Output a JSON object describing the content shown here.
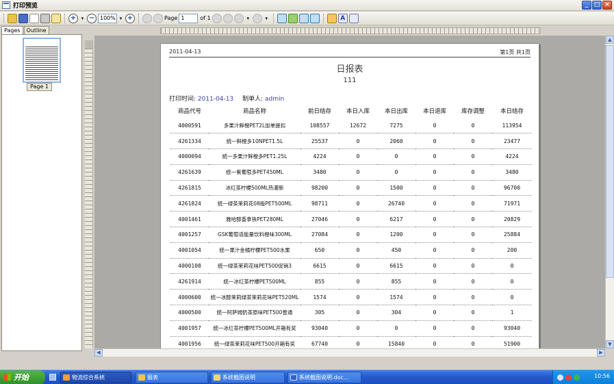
{
  "window": {
    "title": "打印预览"
  },
  "toolbar": {
    "zoom": "100%",
    "page_label": "Page",
    "page_value": "1",
    "of_label": "of 1"
  },
  "left_panel": {
    "tabs": [
      "Pages",
      "Outline"
    ],
    "thumb_label": "Page 1"
  },
  "report": {
    "header_date": "2011-04-13",
    "page_indicator": "第1页 共1页",
    "title": "日报表",
    "subtitle": "111",
    "print_time_label": "打印时间:",
    "print_time_value": "2011-04-13",
    "maker_label": "制单人:",
    "maker_value": "admin",
    "columns": [
      "商品代号",
      "商品名称",
      "前日结存",
      "本日入库",
      "本日出库",
      "本日退库",
      "库存调整",
      "本日结存"
    ],
    "rows": [
      [
        "4000591",
        "多果汁鲜橙PET2L加单提扣",
        "108557",
        "12672",
        "7275",
        "0",
        "0",
        "113954"
      ],
      [
        "4261334",
        "统一鲜橙多10NPET1.5L",
        "25537",
        "0",
        "2060",
        "0",
        "0",
        "23477"
      ],
      [
        "4000094",
        "统一多果汁鲜橙多PET1.25L",
        "4224",
        "0",
        "0",
        "0",
        "0",
        "4224"
      ],
      [
        "4261639",
        "统一紫葡萄多PET450ML",
        "3480",
        "0",
        "0",
        "0",
        "0",
        "3480"
      ],
      [
        "4261815",
        "冰红茶柠檬500ML热灌新",
        "98200",
        "0",
        "1500",
        "0",
        "0",
        "96700"
      ],
      [
        "4261824",
        "统一绿茶茉莉花08版PET500ML",
        "98711",
        "0",
        "26740",
        "0",
        "0",
        "71971"
      ],
      [
        "4001461",
        "雅哈醇香拿铁PET280ML",
        "27046",
        "0",
        "6217",
        "0",
        "0",
        "20829"
      ],
      [
        "4001257",
        "GSK葡萄适能量饮料橙味300ML",
        "27084",
        "0",
        "1200",
        "0",
        "0",
        "25884"
      ],
      [
        "4001054",
        "统一果汁金橘柠檬PET500水果",
        "650",
        "0",
        "450",
        "0",
        "0",
        "200"
      ],
      [
        "4000108",
        "统一绿茶茉莉花味PET500促销3",
        "6615",
        "0",
        "6615",
        "0",
        "0",
        "0"
      ],
      [
        "4261914",
        "统一冰红茶柠檬PET500ML",
        "855",
        "0",
        "855",
        "0",
        "0",
        "0"
      ],
      [
        "4000600",
        "统一冰醇茉莉绿茶茉莉花味PET520ML",
        "1574",
        "0",
        "1574",
        "0",
        "0",
        "0"
      ],
      [
        "4000500",
        "统一阿萨姆奶茶原味PET500普通",
        "305",
        "0",
        "304",
        "0",
        "0",
        "1"
      ],
      [
        "4001957",
        "统一冰红茶柠檬PET500ML开箱有奖",
        "93040",
        "0",
        "0",
        "0",
        "0",
        "93040"
      ],
      [
        "4001956",
        "统一绿茶茉莉花味PET500开箱有奖",
        "67740",
        "0",
        "15840",
        "0",
        "0",
        "51900"
      ]
    ]
  },
  "taskbar": {
    "start_label": "开始",
    "tasks": [
      "物流综合系统",
      "报表",
      "系统截图说明",
      "系统截图说明.doc..."
    ],
    "clock": "10:56"
  }
}
